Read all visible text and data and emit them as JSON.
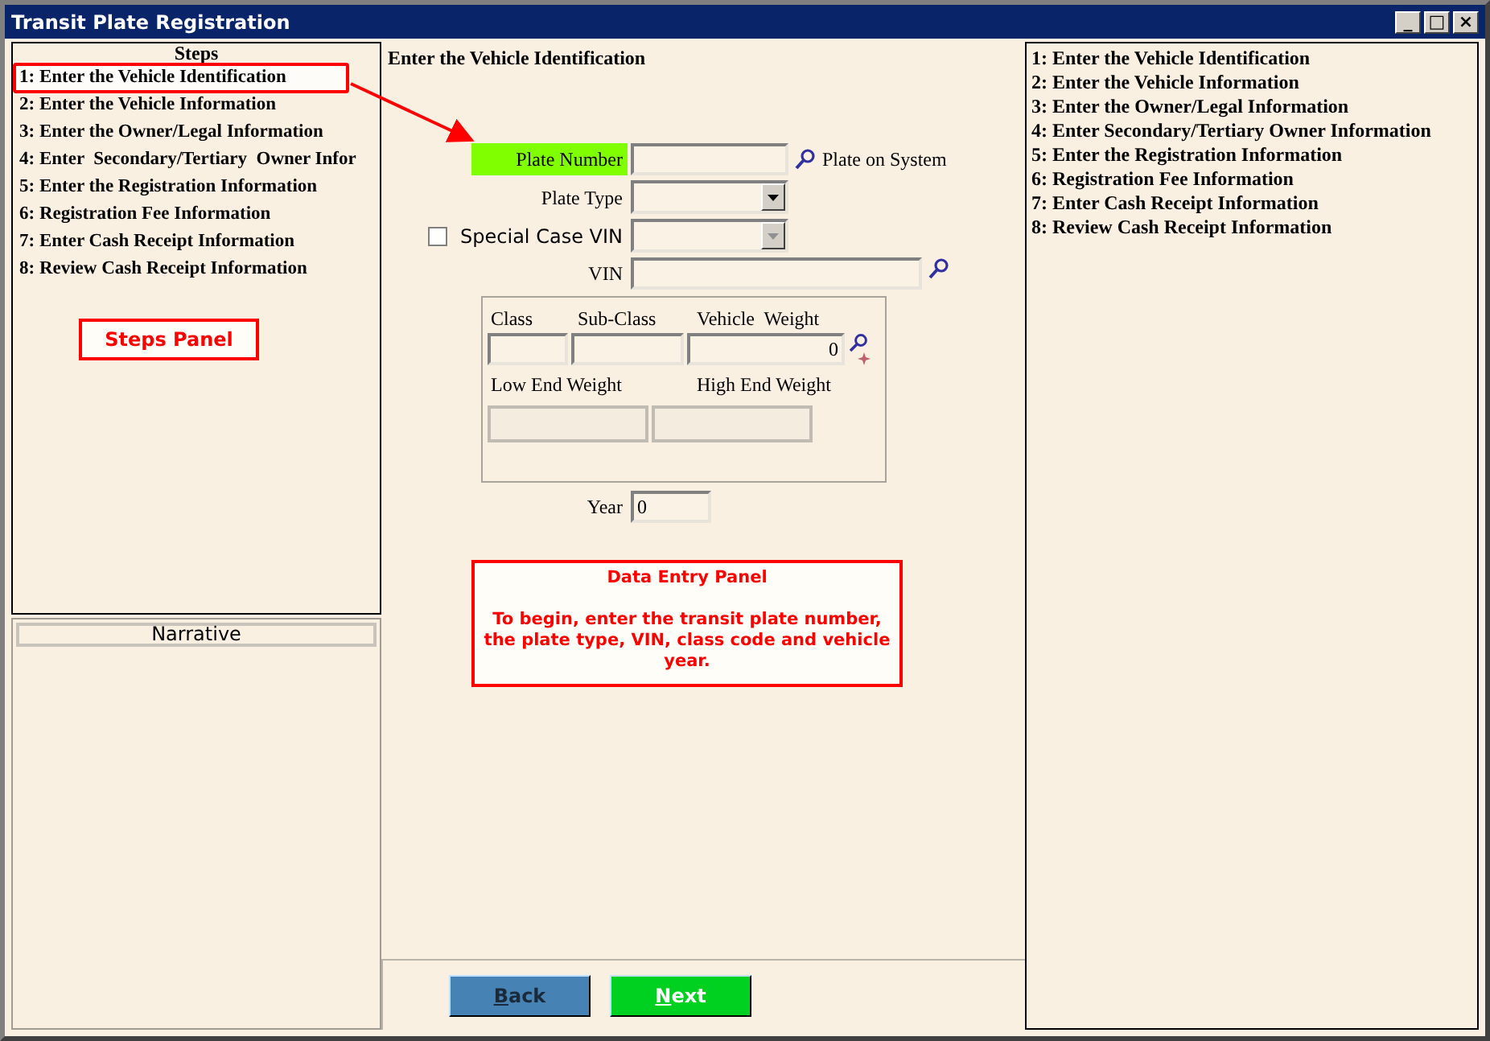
{
  "window": {
    "title": "Transit Plate Registration",
    "controls": [
      "_",
      "□",
      "×"
    ]
  },
  "steps_panel": {
    "title": "Steps",
    "items": [
      {
        "label": "1: Enter the Vehicle Identification",
        "selected": true
      },
      {
        "label": "2: Enter the Vehicle Information",
        "selected": false
      },
      {
        "label": "3: Enter the Owner/Legal Information",
        "selected": false
      },
      {
        "label": "4: Enter  Secondary/Tertiary  Owner Infor",
        "selected": false
      },
      {
        "label": "5: Enter the Registration Information",
        "selected": false
      },
      {
        "label": "6: Registration Fee Information",
        "selected": false
      },
      {
        "label": "7: Enter Cash Receipt Information",
        "selected": false
      },
      {
        "label": "8: Review Cash Receipt Information",
        "selected": false
      }
    ],
    "callout": "Steps Panel"
  },
  "narrative": {
    "title": "Narrative"
  },
  "data_entry": {
    "heading": "Enter the Vehicle Identification",
    "plate_number": {
      "label": "Plate Number",
      "status": "Plate on System"
    },
    "plate_type": {
      "label": "Plate Type",
      "disabled": false
    },
    "special_case_vin": {
      "label": "Special Case VIN",
      "checked": false,
      "disabled": true
    },
    "vin": {
      "label": "VIN"
    },
    "class_group": {
      "class_label": "Class",
      "subclass_label": "Sub-Class",
      "weight_label": "Vehicle  Weight",
      "weight_value": "0",
      "low_label": "Low End Weight",
      "high_label": "High End Weight"
    },
    "year": {
      "label": "Year",
      "value": "0"
    },
    "callout": {
      "title": "Data Entry Panel",
      "text": "To begin, enter the transit plate number, the plate type, VIN, class code and vehicle year."
    },
    "buttons": [
      {
        "label": "Back",
        "kind": "back"
      },
      {
        "label": "Next",
        "kind": "next"
      }
    ]
  },
  "summary_panel": {
    "items": [
      "1: Enter the Vehicle Identification",
      "2: Enter the Vehicle Information",
      "3: Enter the Owner/Legal Information",
      "4: Enter Secondary/Tertiary Owner Information",
      "5: Enter the Registration Information",
      "6: Registration Fee Information",
      "7: Enter Cash Receipt Information",
      "8: Review Cash Receipt Information"
    ]
  }
}
